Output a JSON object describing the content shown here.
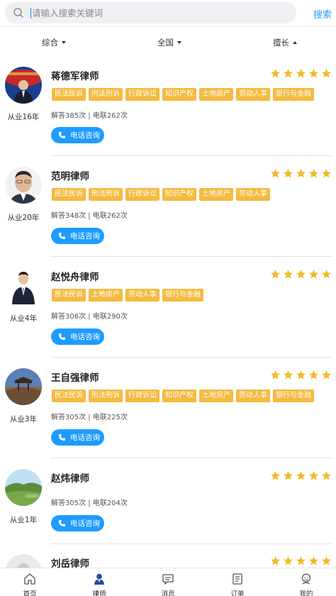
{
  "search": {
    "placeholder": "请输入搜索关键词",
    "button_label": "搜索"
  },
  "filters": [
    {
      "label": "综合",
      "arrow": "down"
    },
    {
      "label": "全国",
      "arrow": "down"
    },
    {
      "label": "擅长",
      "arrow": "up"
    }
  ],
  "lawyers": [
    {
      "name": "蒋德军律师",
      "years": "从业16年",
      "stars": 5,
      "tags": [
        "民法民诉",
        "刑法刑诉",
        "行政诉讼",
        "知识产权",
        "土地房产",
        "劳动人事",
        "银行与金融"
      ],
      "stats": "解答385次 | 电联262次",
      "call_label": "电话咨询"
    },
    {
      "name": "范明律师",
      "years": "从业20年",
      "stars": 5,
      "tags": [
        "民法民诉",
        "刑法刑诉",
        "行政诉讼",
        "知识产权",
        "土地房产",
        "劳动人事"
      ],
      "stats": "解答348次 | 电联262次",
      "call_label": "电话咨询"
    },
    {
      "name": "赵悦舟律师",
      "years": "从业4年",
      "stars": 5,
      "tags": [
        "民法民诉",
        "土地房产",
        "劳动人事",
        "银行与金融"
      ],
      "stats": "解答306次 | 电联290次",
      "call_label": "电话咨询"
    },
    {
      "name": "王自强律师",
      "years": "从业3年",
      "stars": 5,
      "tags": [
        "民法民诉",
        "刑法刑诉",
        "行政诉讼",
        "知识产权",
        "土地房产",
        "劳动人事",
        "银行与金融"
      ],
      "stats": "解答305次 | 电联225次",
      "call_label": "电话咨询"
    },
    {
      "name": "赵炜律师",
      "years": "从业1年",
      "stars": 5,
      "tags": [],
      "stats": "解答305次 | 电联204次",
      "call_label": "电话咨询"
    },
    {
      "name": "刘岳律师",
      "years": "",
      "stars": 5,
      "tags": [],
      "stats": "",
      "call_label": ""
    }
  ],
  "tabbar": [
    {
      "label": "首页",
      "icon": "home-icon"
    },
    {
      "label": "律师",
      "icon": "lawyer-icon"
    },
    {
      "label": "消息",
      "icon": "message-icon"
    },
    {
      "label": "订单",
      "icon": "order-icon"
    },
    {
      "label": "我的",
      "icon": "profile-icon"
    }
  ],
  "colors": {
    "accent": "#1e9bff",
    "tag": "#f5ba3f",
    "star": "#f5b829"
  }
}
